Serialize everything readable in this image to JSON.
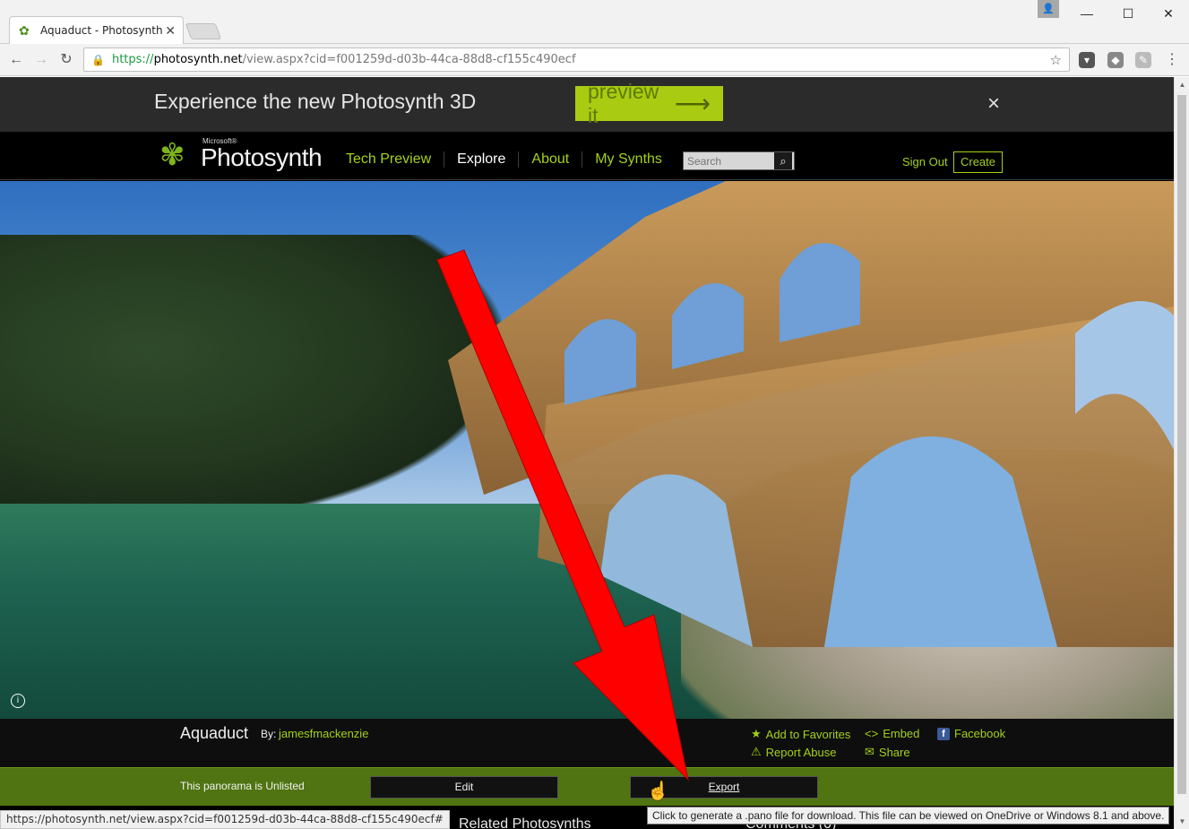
{
  "browser": {
    "tab_title": "Aquaduct - Photosynth",
    "url_scheme": "https://",
    "url_host": "photosynth.net",
    "url_path": "/view.aspx?cid=f001259d-d03b-44ca-88d8-cf155c490ecf",
    "status_url": "https://photosynth.net/view.aspx?cid=f001259d-d03b-44ca-88d8-cf155c490ecf#"
  },
  "promo": {
    "text": "Experience the new Photosynth 3D",
    "button": "preview it",
    "close": "×"
  },
  "nav": {
    "logo_microsoft": "Microsoft®",
    "logo_text": "Photosynth",
    "links": [
      "Tech Preview",
      "Explore",
      "About",
      "My Synths"
    ],
    "search_placeholder": "Search",
    "sign_out": "Sign Out",
    "create": "Create"
  },
  "synth": {
    "title": "Aquaduct",
    "by_label": "By:",
    "author": "jamesfmackenzie",
    "actions": {
      "favorites": "Add to Favorites",
      "report": "Report Abuse",
      "embed": "Embed",
      "share": "Share",
      "facebook": "Facebook"
    }
  },
  "action_bar": {
    "status": "This panorama is Unlisted",
    "edit": "Edit",
    "export": "Export"
  },
  "below": {
    "related": "Related Photosynths",
    "comments": "Comments (0)"
  },
  "tooltip": "Click to generate a .pano file for download. This file can be viewed on OneDrive or Windows 8.1 and above.",
  "colors": {
    "accent_green": "#a3d11a",
    "action_bar_green": "#4f7411",
    "annotation_arrow": "#ff0000"
  }
}
